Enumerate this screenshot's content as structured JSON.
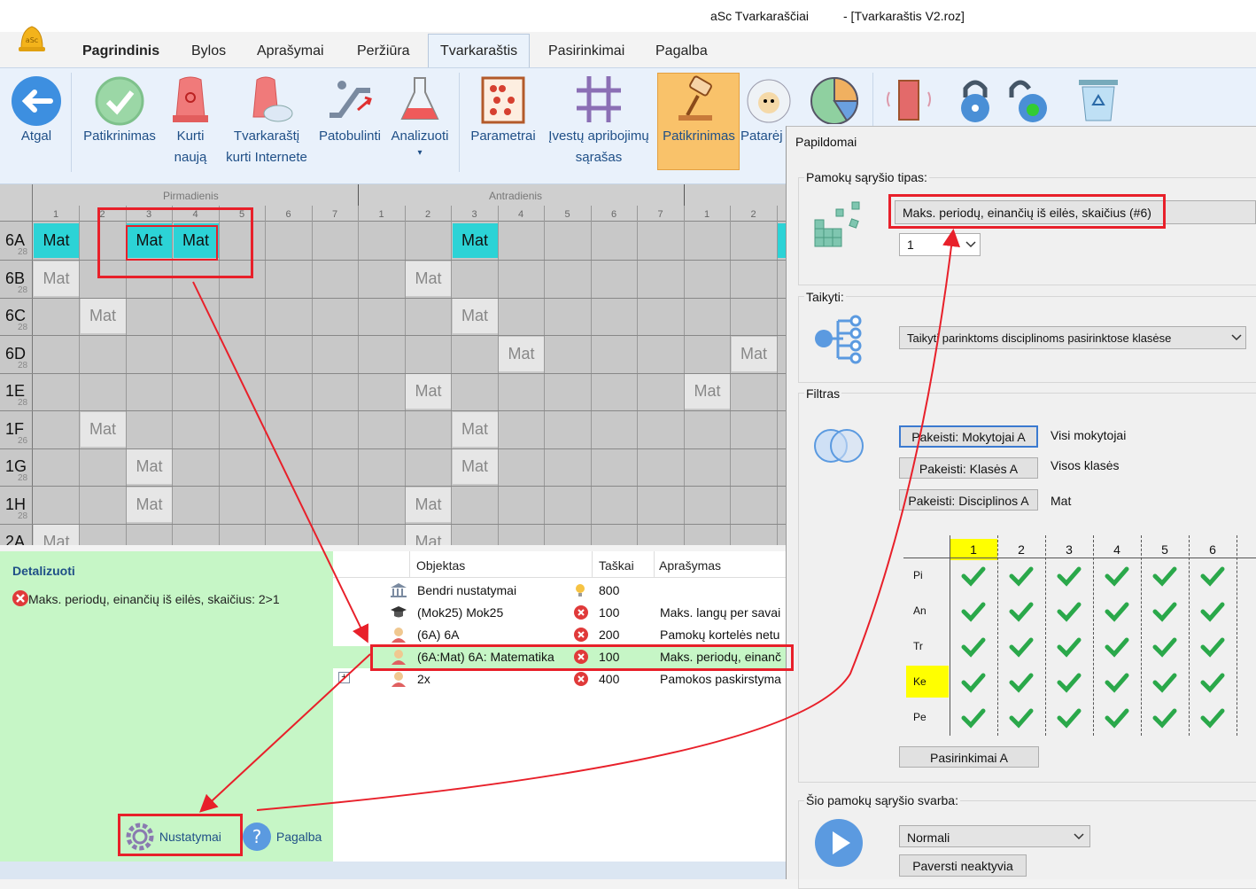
{
  "window": {
    "app_title": "aSc Tvarkaraščiai",
    "file_title": "- [Tvarkaraštis V2.roz]"
  },
  "menu": {
    "tabs": [
      "Pagrindinis",
      "Bylos",
      "Aprašymai",
      "Peržiūra",
      "Tvarkaraštis",
      "Pasirinkimai",
      "Pagalba"
    ],
    "active": "Tvarkaraštis"
  },
  "ribbon": {
    "back": "Atgal",
    "check": "Patikrinimas",
    "create_new_1": "Kurti",
    "create_new_2": "naują",
    "create_online_1": "Tvarkaraštį",
    "create_online_2": "kurti Internete",
    "improve": "Patobulinti",
    "analyze": "Analizuoti",
    "analyze_caret": "▾",
    "params": "Parametrai",
    "constraints_1": "Įvestų apribojimų",
    "constraints_2": "sąrašas",
    "checking": "Patikrinimas",
    "advice": "Patarėj"
  },
  "grid": {
    "days": [
      "Pirmadienis",
      "Antradienis"
    ],
    "periods": [
      "1",
      "2",
      "3",
      "4",
      "5",
      "6",
      "7",
      "1",
      "2",
      "3",
      "4",
      "5",
      "6",
      "7",
      "1",
      "2"
    ],
    "rows": [
      {
        "name": "6A",
        "count": "28"
      },
      {
        "name": "6B",
        "count": "28"
      },
      {
        "name": "6C",
        "count": "28"
      },
      {
        "name": "6D",
        "count": "28"
      },
      {
        "name": "1E",
        "count": "28"
      },
      {
        "name": "1F",
        "count": "26"
      },
      {
        "name": "1G",
        "count": "28"
      },
      {
        "name": "1H",
        "count": "28"
      },
      {
        "name": "2A",
        "count": ""
      }
    ],
    "lesson_label": "Mat"
  },
  "detail": {
    "title": "Detalizuoti",
    "message": "Maks. periodų, einančių iš eilės, skaičius: 2>1",
    "settings_button": "Nustatymai",
    "help_button": "Pagalba"
  },
  "list": {
    "headers": {
      "object": "Objektas",
      "points": "Taškai",
      "description": "Aprašymas"
    },
    "rows": [
      {
        "object": "Bendri nustatymai",
        "points": "800",
        "description": ""
      },
      {
        "object": "(Mok25) Mok25",
        "points": "100",
        "description": "Maks. langų per savai"
      },
      {
        "object": "(6A) 6A",
        "points": "200",
        "description": "Pamokų kortelės netu"
      },
      {
        "object": "(6A:Mat) 6A: Matematika",
        "points": "100",
        "description": "Maks. periodų, einanč"
      },
      {
        "object": "2x",
        "points": "400",
        "description": "Pamokos paskirstyma"
      }
    ],
    "expand": "+"
  },
  "dialog": {
    "title": "Papildomai",
    "type_group": "Pamokų sąryšio tipas:",
    "type_value": "Maks. periodų, einančių iš eilės, skaičius (#6)",
    "count_value": "1",
    "apply_group": "Taikyti:",
    "apply_value": "Taikyti parinktoms disciplinoms pasirinktose klasėse",
    "filter_group": "Filtras",
    "filter_buttons": [
      "Pakeisti: Mokytojai A",
      "Pakeisti: Klasės A",
      "Pakeisti: Disciplinos A"
    ],
    "filter_values": [
      "Visi mokytojai",
      "Visos klasės",
      "Mat"
    ],
    "periods": [
      "1",
      "2",
      "3",
      "4",
      "5",
      "6"
    ],
    "days": [
      "Pi",
      "An",
      "Tr",
      "Ke",
      "Pe"
    ],
    "options_button": "Pasirinkimai A",
    "weight_group": "Šio pamokų sąryšio svarba:",
    "weight_value": "Normali",
    "deactivate_button": "Paversti neaktyvia"
  },
  "colors": {
    "accent": "#1f4f87",
    "highlight_red": "#e8202a",
    "lesson_cyan": "#2cd3d6",
    "green_panel": "#c6f6c6"
  }
}
